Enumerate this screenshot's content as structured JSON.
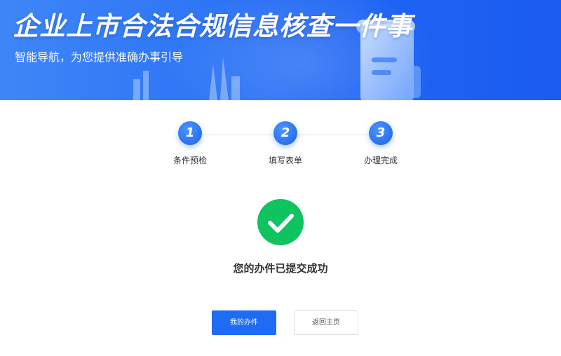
{
  "banner": {
    "title": "企业上市合法合规信息核查一件事",
    "subtitle": "智能导航，为您提供准确办事引导"
  },
  "steps": [
    {
      "number": "1",
      "label": "条件预检"
    },
    {
      "number": "2",
      "label": "填写表单"
    },
    {
      "number": "3",
      "label": "办理完成"
    }
  ],
  "result": {
    "message": "您的办件已提交成功"
  },
  "buttons": {
    "primary_label": "我的办件",
    "secondary_label": "返回主页"
  },
  "colors": {
    "accent": "#1f6cf4",
    "success": "#0fc35f",
    "banner_start": "#3f86f7",
    "banner_end": "#1b5bf0"
  },
  "icons": {
    "success": "check-circle-icon"
  }
}
